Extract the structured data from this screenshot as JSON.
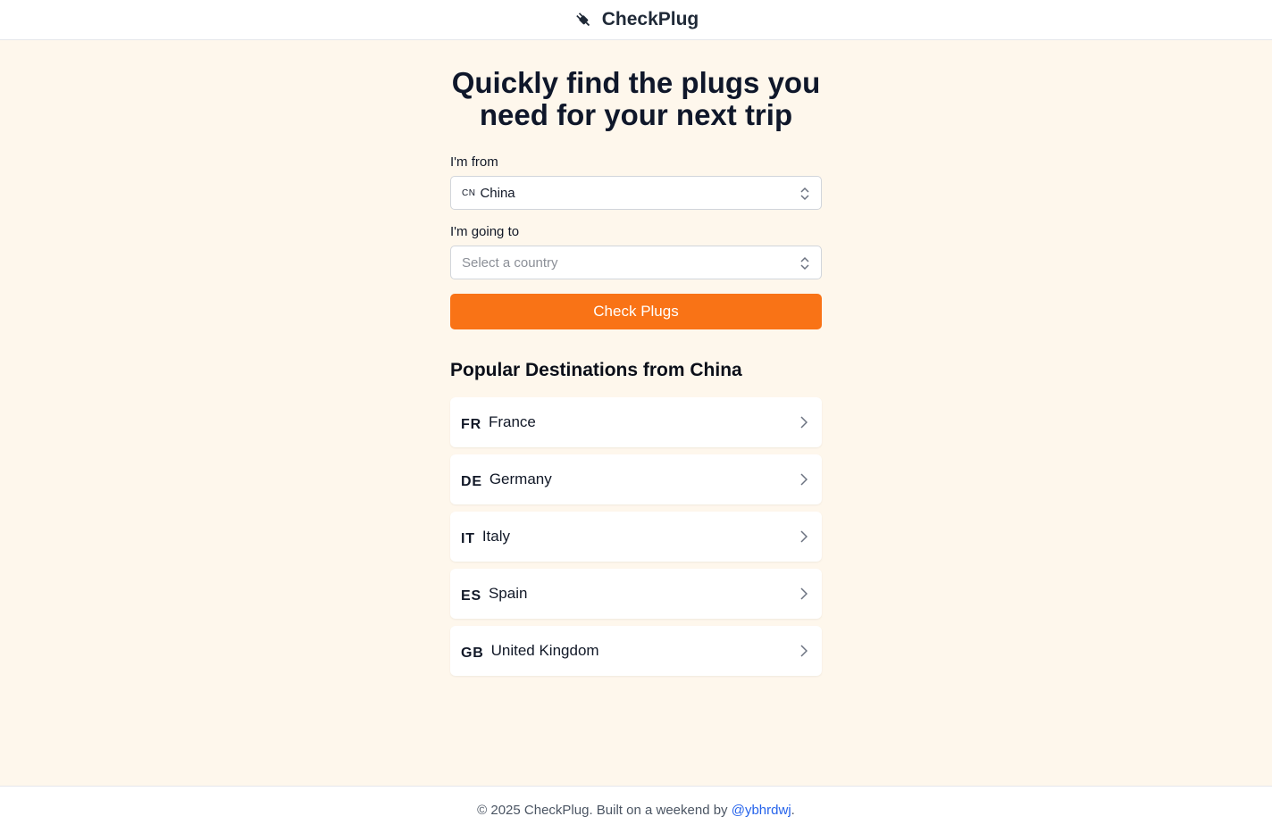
{
  "header": {
    "brand": "CheckPlug",
    "logo_icon": "plug-icon"
  },
  "hero": {
    "title": "Quickly find the plugs you need for your next trip"
  },
  "form": {
    "from_label": "I'm from",
    "from_code": "CN",
    "from_value": "China",
    "to_label": "I'm going to",
    "to_placeholder": "Select a country",
    "submit_label": "Check Plugs"
  },
  "popular": {
    "title": "Popular Destinations from China",
    "items": [
      {
        "code": "FR",
        "name": "France"
      },
      {
        "code": "DE",
        "name": "Germany"
      },
      {
        "code": "IT",
        "name": "Italy"
      },
      {
        "code": "ES",
        "name": "Spain"
      },
      {
        "code": "GB",
        "name": "United Kingdom"
      }
    ]
  },
  "footer": {
    "text": "© 2025 CheckPlug. Built on a weekend by",
    "link": "@ybhrdwj",
    "end": "."
  },
  "colors": {
    "background": "#fef7ec",
    "accent": "#f97316",
    "link": "#2563eb"
  }
}
